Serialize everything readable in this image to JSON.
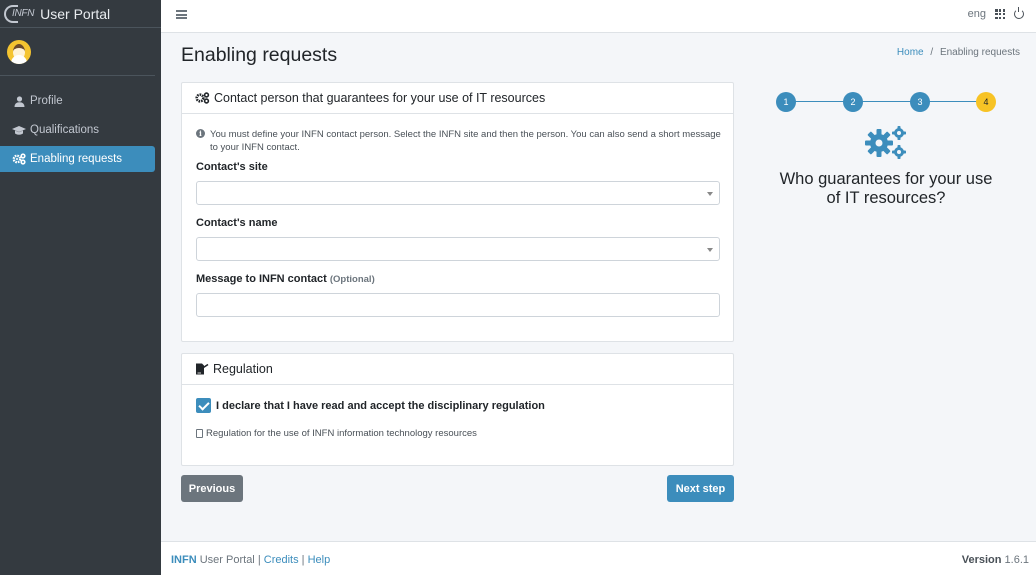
{
  "brand": {
    "logo_text": "INFN",
    "title": "User Portal"
  },
  "sidebar": {
    "items": [
      {
        "label": "Profile",
        "icon": "user-icon",
        "active": false
      },
      {
        "label": "Qualifications",
        "icon": "graduation-cap-icon",
        "active": false
      },
      {
        "label": "Enabling requests",
        "icon": "cogs-icon",
        "active": true
      }
    ]
  },
  "topbar": {
    "language": "eng",
    "apps_icon": "grid-icon",
    "logout_icon": "power-icon"
  },
  "page": {
    "title": "Enabling requests",
    "breadcrumb": {
      "home": "Home",
      "sep": "/",
      "current": "Enabling requests"
    }
  },
  "contact_card": {
    "header": "Contact person that guarantees for your use of IT resources",
    "info": "You must define your INFN contact person. Select the INFN site and then the person. You can also send a short message to your INFN contact.",
    "site_label": "Contact's site",
    "site_value": "",
    "name_label": "Contact's name",
    "name_value": "",
    "message_label": "Message to INFN contact",
    "message_optional": "(Optional)",
    "message_value": ""
  },
  "regulation_card": {
    "header": "Regulation",
    "checkbox_label": "I declare that I have read and accept the disciplinary regulation",
    "checked": true,
    "link_text": "Regulation for the use of INFN information technology resources"
  },
  "buttons": {
    "previous": "Previous",
    "next": "Next step"
  },
  "stepper": {
    "steps": [
      "1",
      "2",
      "3",
      "4"
    ],
    "current": 4,
    "question": "Who guarantees for your use of IT resources?"
  },
  "footer": {
    "brand": "INFN",
    "portal": "User Portal",
    "sep": "|",
    "credits": "Credits",
    "help": "Help",
    "version_label": "Version",
    "version": "1.6.1"
  },
  "colors": {
    "accent": "#3c8dbc",
    "sidebar": "#343a40",
    "current_step": "#f7c325",
    "secondary": "#6c757d"
  }
}
